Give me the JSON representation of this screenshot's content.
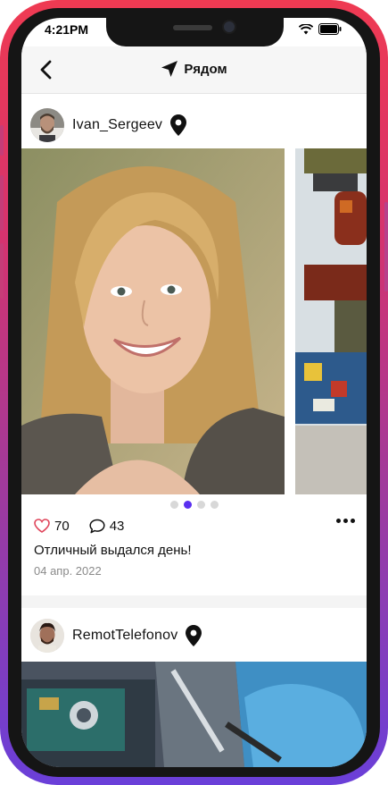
{
  "status_bar": {
    "time": "4:21PM"
  },
  "header": {
    "title": "Рядом"
  },
  "posts": [
    {
      "username": "Ivan_Sergeev",
      "likes": "70",
      "comments": "43",
      "caption": "Отличный выдался день!",
      "date": "04 апр. 2022",
      "carousel": {
        "total": 4,
        "active": 2
      }
    },
    {
      "username": "RemotTelefonov"
    }
  ],
  "colors": {
    "accent": "#5a2ff0",
    "like": "#e0455b",
    "frame_top": "#ef3a52",
    "frame_bottom": "#6a3fd9"
  }
}
